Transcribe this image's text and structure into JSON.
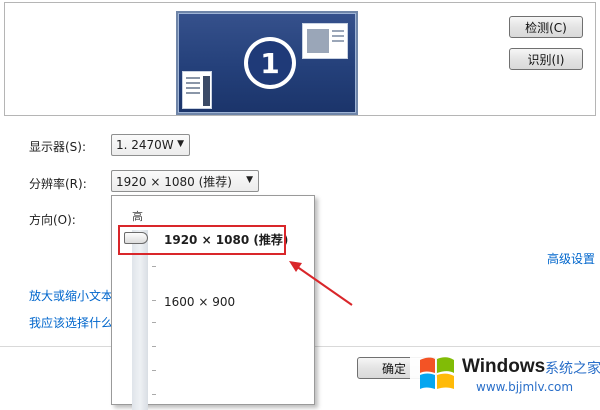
{
  "preview": {
    "monitor_number": "1",
    "detect_button": "检测(C)",
    "identify_button": "识别(I)"
  },
  "settings": {
    "display_label": "显示器(S):",
    "display_value": "1. 2470W",
    "resolution_label": "分辨率(R):",
    "resolution_value": "1920 × 1080 (推荐)",
    "orientation_label": "方向(O):",
    "advanced_link": "高级设置",
    "text_size_link": "放大或缩小文本",
    "which_settings_link": "我应该选择什么",
    "ok_button": "确定"
  },
  "resolution_dropdown": {
    "high_label": "高",
    "options": [
      "1920 × 1080 (推荐)",
      "1600 × 900"
    ],
    "selected_index": 0
  },
  "watermark": {
    "title": "Windows",
    "subtitle": "系统之家",
    "url": "www.bjjmlv.com"
  },
  "colors": {
    "link": "#0066cc",
    "highlight_box": "#d9262a",
    "monitor_bg": "#24407a"
  }
}
